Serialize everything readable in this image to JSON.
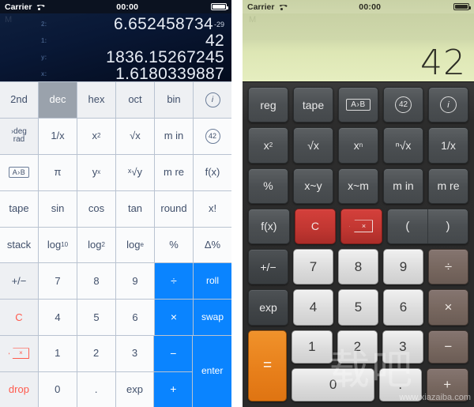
{
  "left_phone": {
    "statusbar": {
      "carrier": "Carrier",
      "wifi_icon": "wifi-icon",
      "time": "00:00",
      "battery_icon": "battery-icon"
    },
    "display": {
      "memory_flag": "M",
      "rows": [
        {
          "label": "2:",
          "value": "6.652458734",
          "exponent": "-29"
        },
        {
          "label": "1:",
          "value": "42",
          "exponent": ""
        },
        {
          "label": "y:",
          "value": "1836.15267245",
          "exponent": ""
        },
        {
          "label": "x:",
          "value": "1.6180339887",
          "exponent": ""
        }
      ]
    },
    "rows": [
      [
        {
          "label": "2nd",
          "style": "fn"
        },
        {
          "label": "dec",
          "style": "sel"
        },
        {
          "label": "hex",
          "style": "fn"
        },
        {
          "label": "oct",
          "style": "fn"
        },
        {
          "label": "bin",
          "style": "fn"
        },
        {
          "label": "i",
          "style": "circle-i"
        }
      ],
      [
        {
          "label": "deg",
          "label2": "rad",
          "style": "degrad"
        },
        {
          "label": "1/x",
          "style": "plain"
        },
        {
          "label": "x2",
          "style": "sup",
          "base": "x",
          "sup": "2"
        },
        {
          "label": "√x",
          "style": "plain"
        },
        {
          "label": "m in",
          "style": "plain"
        },
        {
          "label": "42",
          "style": "circle-42"
        }
      ],
      [
        {
          "label": "A›B",
          "style": "boxab"
        },
        {
          "label": "π",
          "style": "plain"
        },
        {
          "label": "yx",
          "style": "sup",
          "base": "y",
          "sup": "x"
        },
        {
          "label": "ˣ√y",
          "style": "plain"
        },
        {
          "label": "m re",
          "style": "plain"
        },
        {
          "label": "f(x)",
          "style": "plain"
        }
      ],
      [
        {
          "label": "tape",
          "style": "plain"
        },
        {
          "label": "sin",
          "style": "plain"
        },
        {
          "label": "cos",
          "style": "plain"
        },
        {
          "label": "tan",
          "style": "plain"
        },
        {
          "label": "round",
          "style": "plain"
        },
        {
          "label": "x!",
          "style": "plain"
        }
      ],
      [
        {
          "label": "stack",
          "style": "plain"
        },
        {
          "label": "log10",
          "style": "sub",
          "base": "log",
          "sub": "10"
        },
        {
          "label": "log2",
          "style": "sub",
          "base": "log",
          "sub": "2"
        },
        {
          "label": "loge",
          "style": "sub",
          "base": "log",
          "sub": "e"
        },
        {
          "label": "%",
          "style": "plain"
        },
        {
          "label": "Δ%",
          "style": "plain"
        }
      ],
      [
        {
          "label": "+/−",
          "style": "fn"
        },
        {
          "label": "7",
          "style": "plain"
        },
        {
          "label": "8",
          "style": "plain"
        },
        {
          "label": "9",
          "style": "plain"
        },
        {
          "label": "÷",
          "style": "blue"
        },
        {
          "label": "roll",
          "style": "blue-sm"
        }
      ],
      [
        {
          "label": "C",
          "style": "red"
        },
        {
          "label": "4",
          "style": "plain"
        },
        {
          "label": "5",
          "style": "plain"
        },
        {
          "label": "6",
          "style": "plain"
        },
        {
          "label": "×",
          "style": "blue"
        },
        {
          "label": "swap",
          "style": "blue-sm"
        }
      ],
      [
        {
          "label": "backspace",
          "style": "backspace"
        },
        {
          "label": "1",
          "style": "plain"
        },
        {
          "label": "2",
          "style": "plain"
        },
        {
          "label": "3",
          "style": "plain"
        },
        {
          "label": "−",
          "style": "blue"
        },
        {
          "label": "enter",
          "style": "blue-sm"
        }
      ],
      [
        {
          "label": "drop",
          "style": "red"
        },
        {
          "label": "0",
          "style": "plain"
        },
        {
          "label": ".",
          "style": "plain"
        },
        {
          "label": "exp",
          "style": "plain"
        },
        {
          "label": "+",
          "style": "blue"
        }
      ]
    ],
    "colors": {
      "accent_blue": "#0a84ff",
      "red": "#ff5a4d",
      "selected_gray": "#9aa2ac",
      "display_bg": "#091836"
    }
  },
  "right_phone": {
    "statusbar": {
      "carrier": "Carrier",
      "wifi_icon": "wifi-icon",
      "time": "00:00",
      "battery_icon": "battery-icon"
    },
    "display": {
      "memory_flag": "M",
      "value": "42"
    },
    "rows": [
      [
        {
          "label": "reg",
          "style": "dark"
        },
        {
          "label": "tape",
          "style": "dark"
        },
        {
          "label": "A›B",
          "style": "boxab"
        },
        {
          "label": "42",
          "style": "circle-42"
        },
        {
          "label": "i",
          "style": "circle-i"
        }
      ],
      [
        {
          "label": "x2",
          "style": "sup",
          "base": "x",
          "sup": "2"
        },
        {
          "label": "√x",
          "style": "dark"
        },
        {
          "label": "xn",
          "style": "sup",
          "base": "x",
          "sup": "n"
        },
        {
          "label": "ⁿ√x",
          "style": "dark"
        },
        {
          "label": "1/x",
          "style": "dark"
        }
      ],
      [
        {
          "label": "%",
          "style": "dark"
        },
        {
          "label": "x~y",
          "style": "dark"
        },
        {
          "label": "x~m",
          "style": "dark"
        },
        {
          "label": "m in",
          "style": "dark"
        },
        {
          "label": "m re",
          "style": "dark"
        }
      ],
      [
        {
          "label": "f(x)",
          "style": "dark"
        },
        {
          "label": "C",
          "style": "red"
        },
        {
          "label": "backspace",
          "style": "red-backspace"
        },
        {
          "label": "(",
          "style": "paren"
        },
        {
          "label": ")",
          "style": "paren"
        }
      ],
      [
        {
          "label": "+/−",
          "style": "dark2"
        },
        {
          "label": "7",
          "style": "light"
        },
        {
          "label": "8",
          "style": "light"
        },
        {
          "label": "9",
          "style": "light"
        },
        {
          "label": "÷",
          "style": "brown"
        }
      ],
      [
        {
          "label": "exp",
          "style": "dark2"
        },
        {
          "label": "4",
          "style": "light"
        },
        {
          "label": "5",
          "style": "light"
        },
        {
          "label": "6",
          "style": "light"
        },
        {
          "label": "×",
          "style": "brown"
        }
      ]
    ],
    "bottom": {
      "equals": "=",
      "line1": [
        {
          "label": "1",
          "style": "light"
        },
        {
          "label": "2",
          "style": "light"
        },
        {
          "label": "3",
          "style": "light"
        },
        {
          "label": "−",
          "style": "brown"
        }
      ],
      "line2": [
        {
          "label": "0",
          "style": "light-wide"
        },
        {
          "label": ".",
          "style": "light"
        },
        {
          "label": "+",
          "style": "brown"
        }
      ]
    },
    "colors": {
      "orange": "#e8801b",
      "red": "#c23732",
      "brown": "#77675f",
      "lcd_bg": "#d5dead",
      "body": "#2c2c2c"
    }
  },
  "watermark": {
    "glyphs": "载吧",
    "url": "www.xiazaiba.com"
  }
}
